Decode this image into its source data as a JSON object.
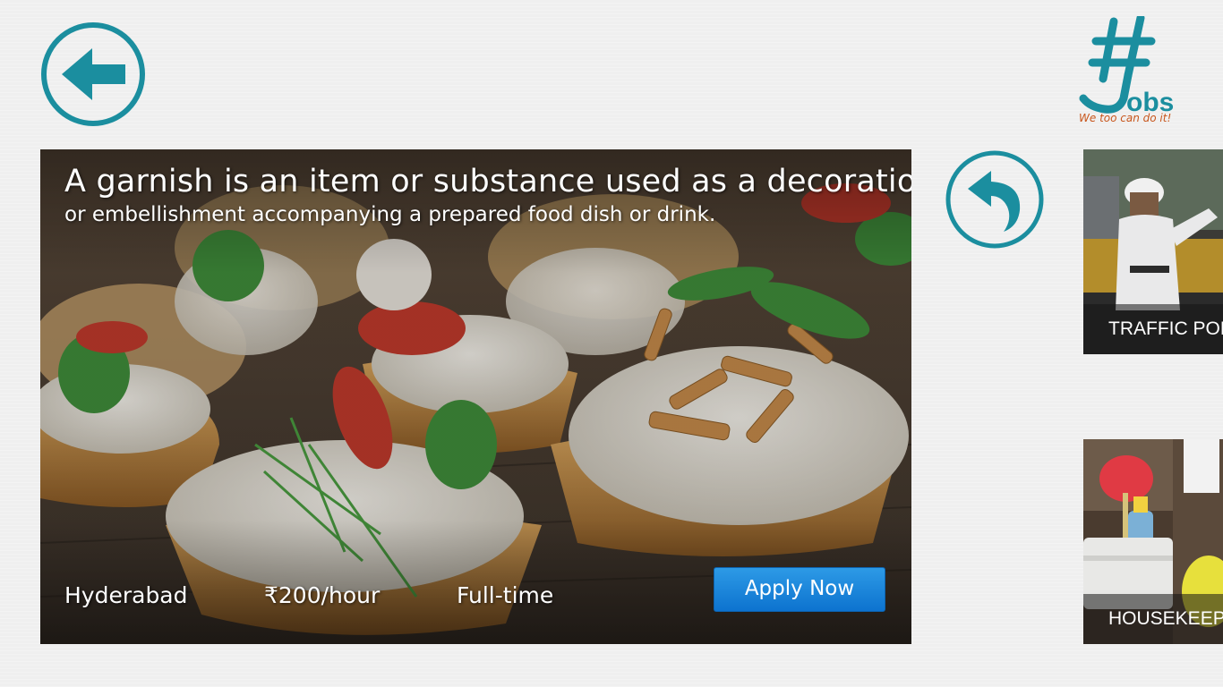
{
  "header": {
    "back_icon": "arrow-left-circle-icon",
    "logo": {
      "text": "#Jobs",
      "tagline": "We too can do it!"
    }
  },
  "featured_job": {
    "title": "A garnish is an item or substance used as a decoration",
    "subtitle": "or embellishment accompanying a prepared food dish or drink.",
    "location": "Hyderabad",
    "pay": "₹200/hour",
    "type": "Full-time",
    "apply_label": "Apply Now",
    "image": "garnished-tarts-photo"
  },
  "share_icon": "reply-arrow-circle-icon",
  "side_jobs": [
    {
      "label": "TRAFFIC POLI",
      "image": "traffic-police-photo"
    },
    {
      "label": "HOUSEKEEPIN",
      "image": "housekeeping-photo"
    }
  ],
  "colors": {
    "accent": "#1b8e9f",
    "apply_button": "#1a84dc",
    "tagline": "#c8561c",
    "background": "#efefef"
  }
}
